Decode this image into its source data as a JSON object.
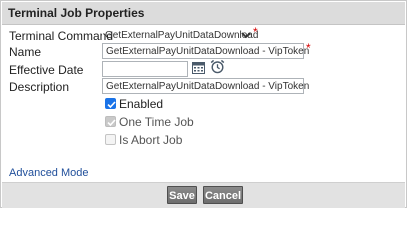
{
  "dialog": {
    "title": "Terminal Job Properties"
  },
  "form": {
    "terminal_command": {
      "label": "Terminal Command",
      "value": "GetExternalPayUnitDataDownload",
      "required_mark": "*"
    },
    "name": {
      "label": "Name",
      "value": "GetExternalPayUnitDataDownload - VipToken",
      "required_mark": "*"
    },
    "effective_date": {
      "label": "Effective Date",
      "value": ""
    },
    "description": {
      "label": "Description",
      "value": "GetExternalPayUnitDataDownload - VipToken"
    },
    "options": [
      {
        "label": "Enabled",
        "checked": true,
        "disabled": false
      },
      {
        "label": "One Time Job",
        "checked": true,
        "disabled": true
      },
      {
        "label": "Is Abort Job",
        "checked": false,
        "disabled": true
      }
    ]
  },
  "advanced_mode_link": "Advanced Mode",
  "footer": {
    "save_label": "Save",
    "cancel_label": "Cancel"
  },
  "colors": {
    "accent": "#1a73e8",
    "required": "#d40000",
    "link": "#1f4e9a",
    "button": "#7a7a7a"
  },
  "icons": [
    "chevron-down-icon",
    "calendar-icon",
    "alarm-clock-icon",
    "checkmark-icon"
  ]
}
